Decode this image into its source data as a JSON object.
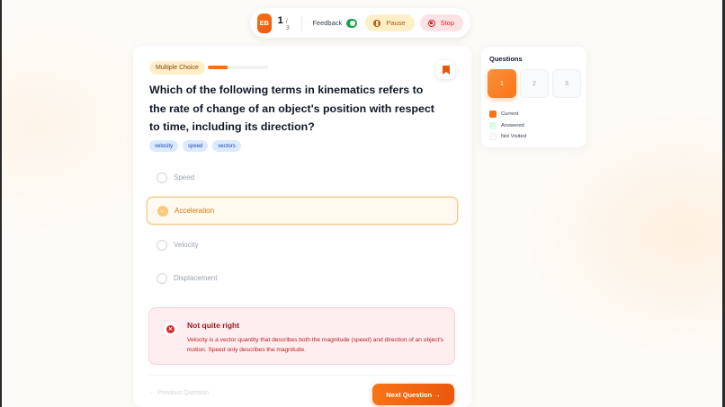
{
  "header": {
    "avatar_initials": "EB",
    "current_question": "1",
    "total_questions": "/ 3",
    "feedback_label": "Feedback",
    "feedback_enabled": true,
    "pause_label": "Pause",
    "stop_label": "Stop"
  },
  "question": {
    "type_label": "Multiple Choice",
    "progress_fraction": 0.333,
    "text": "Which of the following terms in kinematics refers to the rate of change of an object's position with respect to time, including its direction?",
    "tags": [
      "velocity",
      "speed",
      "vectors"
    ],
    "options": [
      {
        "label": "Speed",
        "selected": false
      },
      {
        "label": "Acceleration",
        "selected": true
      },
      {
        "label": "Velocity",
        "selected": false
      },
      {
        "label": "Displacement",
        "selected": false
      }
    ]
  },
  "feedback": {
    "title": "Not quite right",
    "text": "Velocity is a vector quantity that describes both the magnitude (speed) and direction of an object's motion. Speed only describes the magnitude."
  },
  "navigation": {
    "prev_label": "← Previous Question",
    "next_label": "Next Question →"
  },
  "sidebar": {
    "title": "Questions",
    "questions": [
      "1",
      "2",
      "3"
    ],
    "legend": [
      {
        "label": "Current",
        "color": "#f97316"
      },
      {
        "label": "Answered",
        "color": "#dcfce7"
      },
      {
        "label": "Not Visited",
        "color": "#f9fafb"
      }
    ]
  },
  "colors": {
    "accent": "#f97316",
    "error": "#dc2626",
    "toggle_on": "#16a34a"
  }
}
